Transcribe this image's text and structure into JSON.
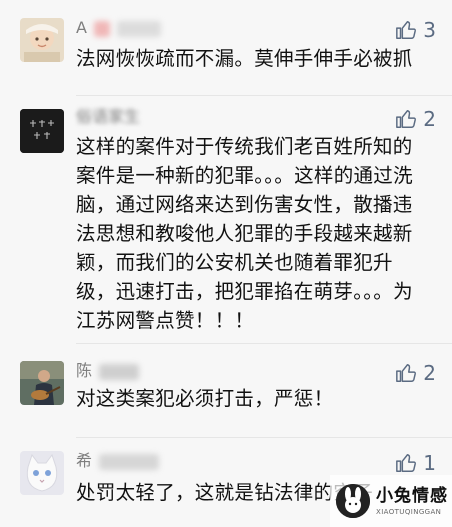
{
  "comments": [
    {
      "name": "A",
      "likes": "3",
      "text": "法网恢恢疏而不漏。莫伸手伸手必被抓",
      "avatar_icon": "baby-avatar-icon"
    },
    {
      "name": "俗语家生",
      "likes": "2",
      "text": "这样的案件对于传统我们老百姓所知的案件是一种新的犯罪。。。这样的通过洗脑，通过网络来达到伤害女性，散播违法思想和教唆他人犯罪的手段越来越新颖，而我们的公安机关也随着罪犯升级，迅速打击，把犯罪掐在萌芽。。。为江苏网警点赞！！！",
      "avatar_text": "东鸣东流行",
      "avatar_icon": "calligraphy-avatar-icon"
    },
    {
      "name": "陈",
      "likes": "2",
      "text": "对这类案犯必须打击，严惩！",
      "avatar_icon": "guitar-player-avatar-icon"
    },
    {
      "name": "希",
      "likes": "1",
      "text": "处罚太轻了，这就是钻法律的空子",
      "avatar_icon": "white-cat-avatar-icon"
    }
  ],
  "watermark": {
    "title": "小兔情感",
    "subtitle": "XIAOTUQINGGAN",
    "icon": "rabbit-logo-icon"
  },
  "colors": {
    "like_icon": "#5b6b82",
    "name_text": "#7f7f7f",
    "comment_text": "#111111",
    "background": "#f7f7f7"
  }
}
